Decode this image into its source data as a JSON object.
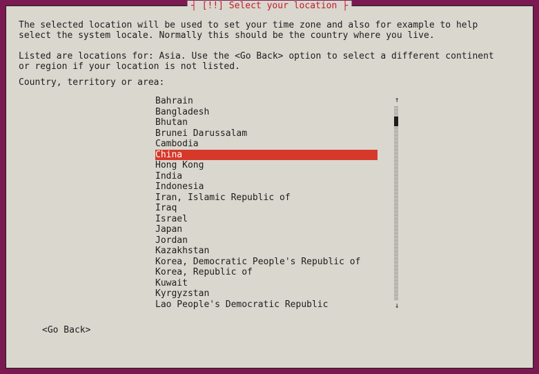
{
  "dialog": {
    "title": "[!!] Select your location",
    "description1": "The selected location will be used to set your time zone and also for example to help\nselect the system locale. Normally this should be the country where you live.",
    "description2": "Listed are locations for: Asia. Use the <Go Back> option to select a different continent\nor region if your location is not listed.",
    "prompt": "Country, territory or area:",
    "selected_index": 5,
    "items": [
      "Bahrain",
      "Bangladesh",
      "Bhutan",
      "Brunei Darussalam",
      "Cambodia",
      "China",
      "Hong Kong",
      "India",
      "Indonesia",
      "Iran, Islamic Republic of",
      "Iraq",
      "Israel",
      "Japan",
      "Jordan",
      "Kazakhstan",
      "Korea, Democratic People's Republic of",
      "Korea, Republic of",
      "Kuwait",
      "Kyrgyzstan",
      "Lao People's Democratic Republic"
    ],
    "go_back_label": "<Go Back>",
    "scroll": {
      "up_arrow": "↑",
      "down_arrow": "↓"
    }
  }
}
